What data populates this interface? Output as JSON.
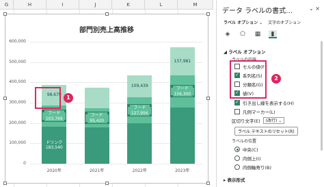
{
  "sheet": {
    "columns": [
      "G",
      "H",
      "I",
      "J",
      "K",
      "L",
      "M"
    ]
  },
  "chart": {
    "title": "部門別売上高推移"
  },
  "chart_data": {
    "type": "bar",
    "stacked": true,
    "categories": [
      "2020年",
      "2021年",
      "2022年",
      "2023年"
    ],
    "series": [
      {
        "name": "ドリンク",
        "values": [
          183540,
          178000,
          198000,
          278000
        ],
        "color": "#3a9a7c"
      },
      {
        "name": "フード",
        "values": [
          103769,
          95420,
          127956,
          156300
        ],
        "color": "#5fbf9a"
      },
      {
        "name": "",
        "values": [
          98679,
          100000,
          109439,
          137981
        ],
        "color": "#a8dcc6"
      }
    ],
    "ylim": [
      0,
      600000
    ],
    "yticks": [
      "0",
      "100,000",
      "200,000",
      "300,000",
      "400,000",
      "500,000",
      "600,000"
    ],
    "label_prefix": [
      "ドリンク",
      "フード",
      ""
    ],
    "label_values": [
      [
        "183,540",
        "103,769",
        "98,679"
      ],
      [
        "",
        "95,420",
        ""
      ],
      [
        "",
        "127,956",
        "109,439"
      ],
      [
        "",
        "156,300",
        "137,981"
      ]
    ],
    "grid": true
  },
  "annotations": {
    "badge1": "1",
    "badge2": "2"
  },
  "pane": {
    "title": "データ ラベルの書式…",
    "controls": "⌄  ×",
    "tab_label_options": "ラベル オプション ⌄",
    "tab_text_options": "文字のオプション",
    "section_label_options": "ラベル オプション",
    "sub_label_contents": "ラベルの内容",
    "options": [
      {
        "label": "セルの値(F)",
        "checked": false
      },
      {
        "label": "系列名(S)",
        "checked": true
      },
      {
        "label": "分類名(G)",
        "checked": false
      },
      {
        "label": "値(V)",
        "checked": true
      },
      {
        "label": "引き出し線を表示する(H)",
        "checked": true
      },
      {
        "label": "凡例マーカー(L)",
        "checked": false
      }
    ],
    "separator_label": "区切り文字(E)",
    "separator_value": "(改行)",
    "reset_button": "ラベル テキストのリセット(R)",
    "position_label": "ラベルの位置",
    "positions": [
      {
        "label": "中央(C)",
        "selected": true
      },
      {
        "label": "内側上(I)",
        "selected": false
      },
      {
        "label": "内側軸寄り(B)",
        "selected": false
      }
    ],
    "section_number_format": "表示形式"
  }
}
